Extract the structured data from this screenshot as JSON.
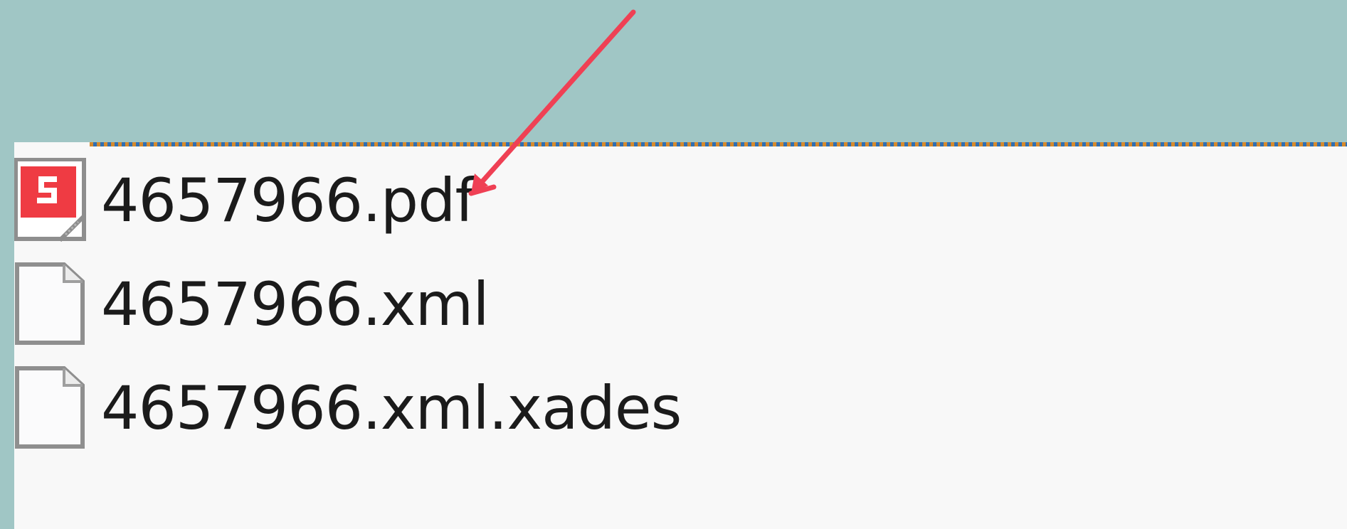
{
  "files": [
    {
      "name": "4657966.pdf",
      "icon": "pdf-file-icon"
    },
    {
      "name": "4657966.xml",
      "icon": "generic-file-icon"
    },
    {
      "name": "4657966.xml.xades",
      "icon": "generic-file-icon"
    }
  ],
  "colors": {
    "background": "#a0c6c5",
    "pane": "#f8f8f8",
    "arrow": "#ef4054",
    "pdf_badge": "#ef3b43",
    "text": "#1b1b1b"
  }
}
